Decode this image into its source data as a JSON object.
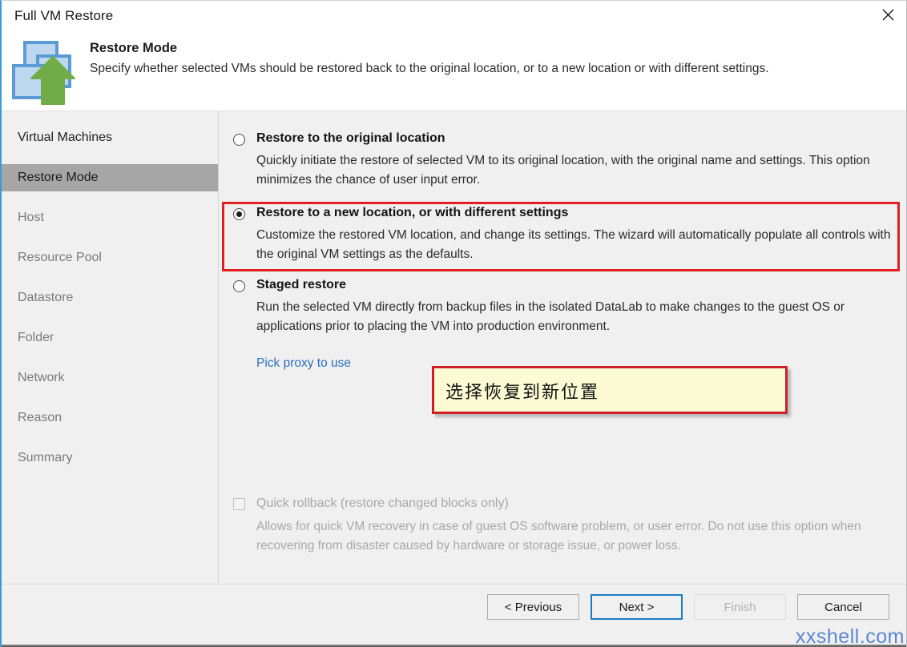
{
  "window": {
    "title": "Full VM Restore",
    "close_icon": "close-icon"
  },
  "header": {
    "icon": "vm-restore-icon",
    "title": "Restore Mode",
    "subtitle": "Specify whether selected VMs should be restored back to the original location, or to a new location or with different settings."
  },
  "sidebar": {
    "items": [
      {
        "label": "Virtual Machines",
        "state": "done"
      },
      {
        "label": "Restore Mode",
        "state": "active"
      },
      {
        "label": "Host",
        "state": "pending"
      },
      {
        "label": "Resource Pool",
        "state": "pending"
      },
      {
        "label": "Datastore",
        "state": "pending"
      },
      {
        "label": "Folder",
        "state": "pending"
      },
      {
        "label": "Network",
        "state": "pending"
      },
      {
        "label": "Reason",
        "state": "pending"
      },
      {
        "label": "Summary",
        "state": "pending"
      }
    ]
  },
  "main": {
    "options": [
      {
        "id": "restore-original",
        "title": "Restore to the original location",
        "description": "Quickly initiate the restore of selected VM to its original location, with the original name and settings. This option minimizes the chance of user input error.",
        "selected": false
      },
      {
        "id": "restore-new",
        "title": "Restore to a new location, or with different settings",
        "description": "Customize the restored VM location, and change its settings. The wizard will automatically populate all controls with the original VM settings as the defaults.",
        "selected": true
      },
      {
        "id": "staged-restore",
        "title": "Staged restore",
        "description": "Run the selected VM directly from backup files in the isolated DataLab to make changes to the guest OS or applications prior to placing the VM into production environment.",
        "selected": false
      }
    ],
    "proxy_link": "Pick proxy to use",
    "quick_rollback": {
      "label": "Quick rollback (restore changed blocks only)",
      "description": "Allows for quick VM recovery in case of guest OS software problem, or user error. Do not use this option when recovering from disaster caused by hardware or storage issue, or power loss.",
      "checked": false,
      "enabled": false
    }
  },
  "annotation": {
    "text": "选择恢复到新位置",
    "background_color": "#fdfbd4",
    "border_color": "#cc2026"
  },
  "highlight": {
    "color": "#e02020",
    "target": "restore-new"
  },
  "footer": {
    "buttons": [
      {
        "id": "previous",
        "label": "< Previous",
        "state": "enabled"
      },
      {
        "id": "next",
        "label": "Next >",
        "state": "focused"
      },
      {
        "id": "finish",
        "label": "Finish",
        "state": "disabled"
      },
      {
        "id": "cancel",
        "label": "Cancel",
        "state": "enabled"
      }
    ]
  },
  "watermark": {
    "text": "xxshell.com",
    "color": "#4f7fd0"
  }
}
